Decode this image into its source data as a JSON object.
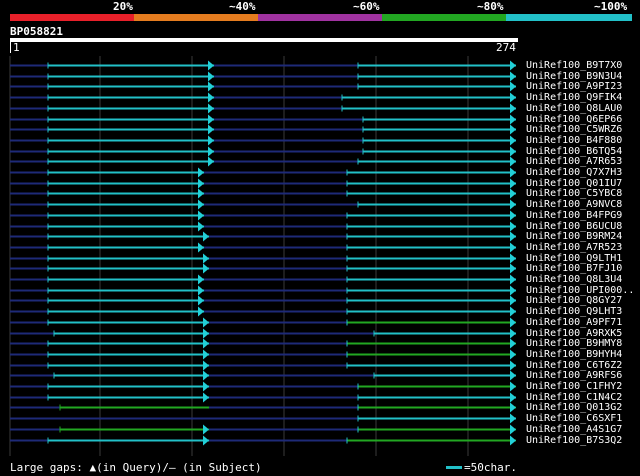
{
  "scale": {
    "labels": [
      "20%",
      "~40%",
      "~60%",
      "~80%",
      "~100%"
    ],
    "colors": [
      "#e8202a",
      "#e57c1f",
      "#a032a0",
      "#22a722",
      "#22c0c8"
    ]
  },
  "query": {
    "id": "BP058821",
    "start": "1",
    "end": "274"
  },
  "legend": {
    "gaps_text": "Large gaps: ▲(in Query)/– (in Subject)",
    "scale_text": "=50char."
  },
  "colors": {
    "hit_cyan": "#22c0c8",
    "hit_green": "#22a722",
    "gap_line": "#1e2a78",
    "grid": "#3a3a3a",
    "arrow_cyan": "#22d0d8",
    "ruler_bar": "#ffffff"
  },
  "hits": [
    {
      "label": "UniRef100_B9T7X0",
      "left": [
        48,
        214
      ],
      "right": [
        358,
        516
      ],
      "color": "cyan",
      "arrowLeft": true
    },
    {
      "label": "UniRef100_B9N3U4",
      "left": [
        48,
        214
      ],
      "right": [
        358,
        516
      ],
      "color": "cyan",
      "arrowLeft": true
    },
    {
      "label": "UniRef100_A9PI23",
      "left": [
        48,
        214
      ],
      "right": [
        358,
        516
      ],
      "color": "cyan",
      "arrowLeft": true
    },
    {
      "label": "UniRef100_Q9FIK4",
      "left": [
        48,
        214
      ],
      "right": [
        342,
        516
      ],
      "color": "cyan",
      "arrowLeft": true
    },
    {
      "label": "UniRef100_Q8LAU0",
      "left": [
        48,
        214
      ],
      "right": [
        342,
        516
      ],
      "color": "cyan",
      "arrowLeft": true
    },
    {
      "label": "UniRef100_Q6EP66",
      "left": [
        48,
        214
      ],
      "right": [
        363,
        516
      ],
      "color": "cyan",
      "arrowLeft": true
    },
    {
      "label": "UniRef100_C5WRZ6",
      "left": [
        48,
        214
      ],
      "right": [
        363,
        516
      ],
      "color": "cyan",
      "arrowLeft": true
    },
    {
      "label": "UniRef100_B4F880",
      "left": [
        48,
        214
      ],
      "right": [
        363,
        516
      ],
      "color": "cyan",
      "arrowLeft": true
    },
    {
      "label": "UniRef100_B6TQ54",
      "left": [
        48,
        214
      ],
      "right": [
        363,
        516
      ],
      "color": "cyan",
      "arrowLeft": true
    },
    {
      "label": "UniRef100_A7R653",
      "left": [
        48,
        214
      ],
      "right": [
        358,
        516
      ],
      "color": "cyan",
      "arrowLeft": true
    },
    {
      "label": "UniRef100_Q7X7H3",
      "left": [
        48,
        204
      ],
      "right": [
        347,
        516
      ],
      "color": "cyan",
      "arrowLeft": true
    },
    {
      "label": "UniRef100_Q01IU7",
      "left": [
        48,
        204
      ],
      "right": [
        347,
        516
      ],
      "color": "cyan",
      "arrowLeft": true
    },
    {
      "label": "UniRef100_C5YBC8",
      "left": [
        48,
        204
      ],
      "right": [
        347,
        516
      ],
      "color": "cyan",
      "arrowLeft": true
    },
    {
      "label": "UniRef100_A9NVC8",
      "left": [
        48,
        204
      ],
      "right": [
        358,
        516
      ],
      "color": "cyan",
      "arrowLeft": true
    },
    {
      "label": "UniRef100_B4FPG9",
      "left": [
        48,
        204
      ],
      "right": [
        347,
        516
      ],
      "color": "cyan",
      "arrowLeft": true
    },
    {
      "label": "UniRef100_B6UCU8",
      "left": [
        48,
        204
      ],
      "right": [
        347,
        516
      ],
      "color": "cyan",
      "arrowLeft": true
    },
    {
      "label": "UniRef100_B9RM24",
      "left": [
        48,
        209
      ],
      "right": [
        347,
        516
      ],
      "color": "cyan",
      "arrowLeft": true
    },
    {
      "label": "UniRef100_A7R523",
      "left": [
        48,
        204
      ],
      "right": [
        347,
        516
      ],
      "color": "cyan",
      "arrowLeft": true
    },
    {
      "label": "UniRef100_Q9LTH1",
      "left": [
        48,
        209
      ],
      "right": [
        347,
        516
      ],
      "color": "cyan",
      "arrowLeft": true
    },
    {
      "label": "UniRef100_B7FJ10",
      "left": [
        48,
        209
      ],
      "right": [
        347,
        516
      ],
      "color": "cyan",
      "arrowLeft": true
    },
    {
      "label": "UniRef100_Q8L3U4",
      "left": [
        48,
        204
      ],
      "right": [
        347,
        516
      ],
      "color": "cyan",
      "arrowLeft": true
    },
    {
      "label": "UniRef100_UPI000..",
      "left": [
        48,
        204
      ],
      "right": [
        347,
        516
      ],
      "color": "cyan",
      "arrowLeft": true
    },
    {
      "label": "UniRef100_Q8GY27",
      "left": [
        48,
        204
      ],
      "right": [
        347,
        516
      ],
      "color": "cyan",
      "arrowLeft": true
    },
    {
      "label": "UniRef100_Q9LHT3",
      "left": [
        48,
        204
      ],
      "right": [
        347,
        516
      ],
      "color": "cyan",
      "arrowLeft": true
    },
    {
      "label": "UniRef100_A9PF71",
      "left": [
        48,
        209
      ],
      "right": [
        347,
        516
      ],
      "color": "mixed",
      "arrowLeft": true
    },
    {
      "label": "UniRef100_A9RXK5",
      "left": [
        54,
        209
      ],
      "right": [
        374,
        516
      ],
      "color": "cyan",
      "arrowLeft": true
    },
    {
      "label": "UniRef100_B9HMY8",
      "left": [
        48,
        209
      ],
      "right": [
        347,
        516
      ],
      "color": "mixed",
      "arrowLeft": true
    },
    {
      "label": "UniRef100_B9HYH4",
      "left": [
        48,
        209
      ],
      "right": [
        347,
        516
      ],
      "color": "mixed",
      "arrowLeft": true
    },
    {
      "label": "UniRef100_C6T6Z2",
      "left": [
        48,
        209
      ],
      "right": [
        347,
        516
      ],
      "color": "cyan",
      "arrowLeft": true
    },
    {
      "label": "UniRef100_A9RFS6",
      "left": [
        54,
        209
      ],
      "right": [
        374,
        516
      ],
      "color": "cyan",
      "arrowLeft": true
    },
    {
      "label": "UniRef100_C1FHY2",
      "left": [
        48,
        209
      ],
      "right": [
        358,
        516
      ],
      "color": "mixed",
      "arrowLeft": true
    },
    {
      "label": "UniRef100_C1N4C2",
      "left": [
        48,
        209
      ],
      "right": [
        358,
        516
      ],
      "color": "cyan",
      "arrowLeft": true
    },
    {
      "label": "UniRef100_Q013G2",
      "left": [
        60,
        209
      ],
      "right": [
        358,
        516
      ],
      "color": "green",
      "arrowLeft": false
    },
    {
      "label": "UniRef100_C6SXF1",
      "left": null,
      "right": [
        358,
        516
      ],
      "color": "cyan",
      "arrowLeft": false
    },
    {
      "label": "UniRef100_A4S1G7",
      "left": [
        60,
        209
      ],
      "right": [
        358,
        516
      ],
      "color": "green",
      "arrowLeft": true
    },
    {
      "label": "UniRef100_B7S3Q2",
      "left": [
        48,
        209
      ],
      "right": [
        347,
        516
      ],
      "color": "mixed",
      "arrowLeft": true
    }
  ]
}
